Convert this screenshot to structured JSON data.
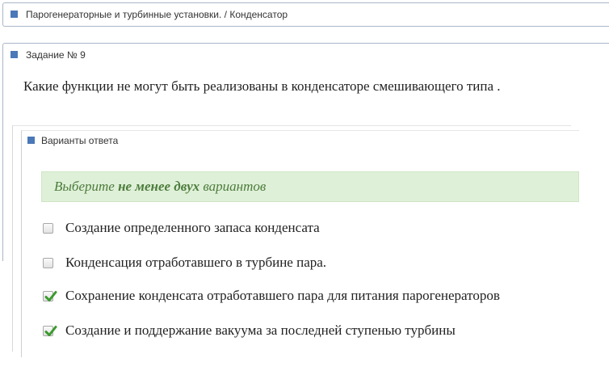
{
  "breadcrumb": {
    "text": "Парогенераторные и турбинные установки. / Конденсатор"
  },
  "task": {
    "title": "Задание № 9",
    "question": "Какие функции  не могут быть реализованы в конденсаторе смешивающего типа ."
  },
  "answers": {
    "title": "Варианты ответа",
    "hint_prefix": "Выберите ",
    "hint_bold": "не менее двух",
    "hint_suffix": " вариантов",
    "options": [
      {
        "label": "Создание определенного запаса конденсата",
        "checked": false
      },
      {
        "label": "Конденсация отработавшего в турбине пара.",
        "checked": false
      },
      {
        "label": "Сохранение конденсата отработавшего пара для питания парогенераторов",
        "checked": true
      },
      {
        "label": "Создание и поддержание вакуума за последней ступенью турбины",
        "checked": true
      }
    ]
  },
  "colors": {
    "header_square": "#4a78b8",
    "hint_background": "#dff0d8",
    "hint_text": "#4c7c3c",
    "checkmark": "#3b9a2e"
  }
}
